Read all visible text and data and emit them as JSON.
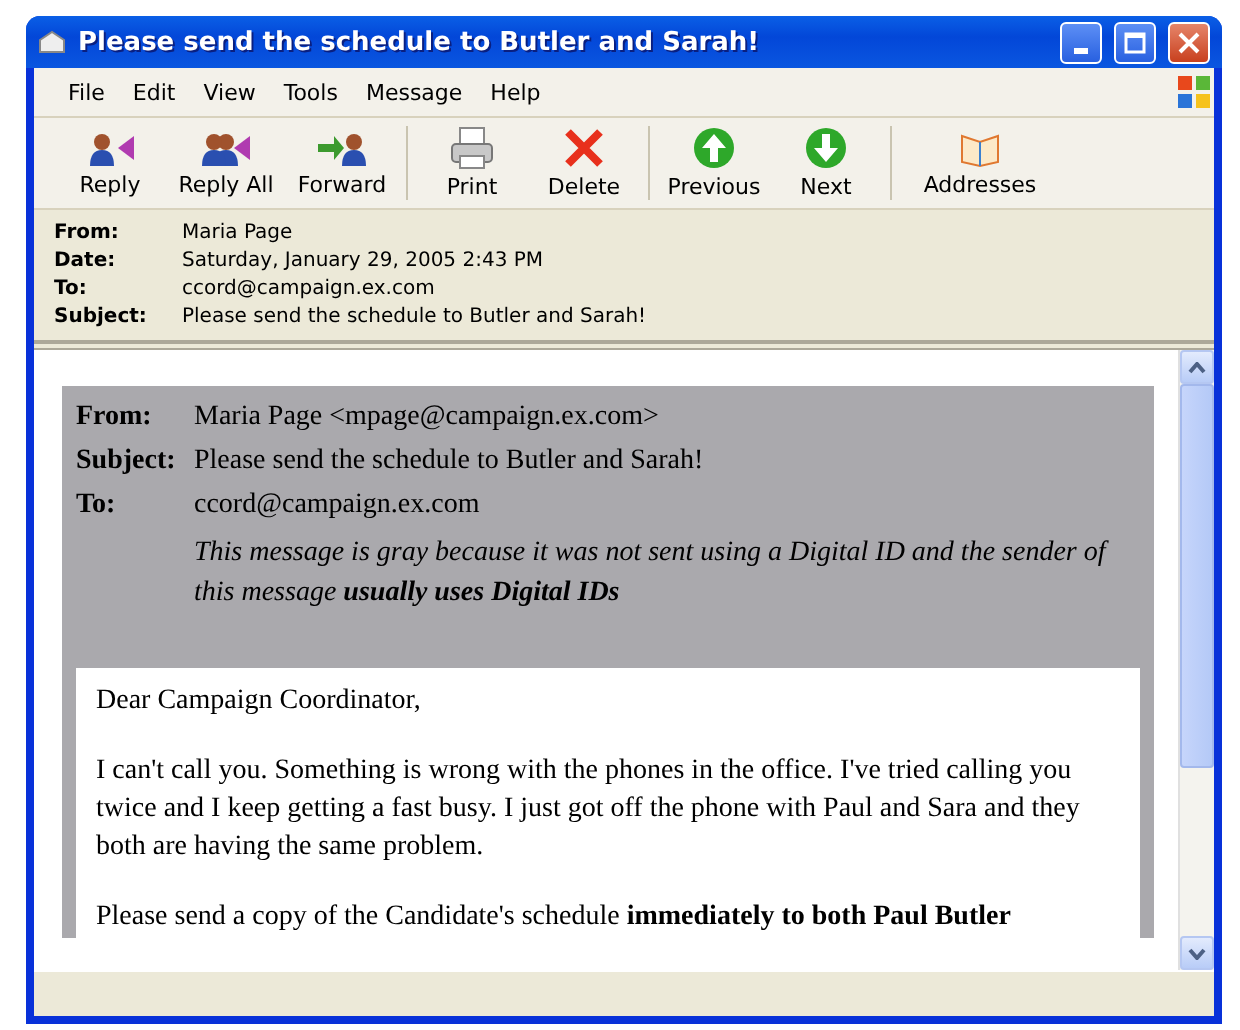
{
  "window": {
    "title": "Please send the schedule to Butler and Sarah!"
  },
  "menu": [
    "File",
    "Edit",
    "View",
    "Tools",
    "Message",
    "Help"
  ],
  "toolbar_groups": [
    [
      {
        "label": "Reply",
        "kind": "reply"
      },
      {
        "label": "Reply All",
        "kind": "replyall"
      },
      {
        "label": "Forward",
        "kind": "forward"
      }
    ],
    [
      {
        "label": "Print",
        "kind": "print"
      },
      {
        "label": "Delete",
        "kind": "delete"
      }
    ],
    [
      {
        "label": "Previous",
        "kind": "up"
      },
      {
        "label": "Next",
        "kind": "down"
      }
    ],
    [
      {
        "label": "Addresses",
        "kind": "book"
      }
    ]
  ],
  "header": [
    {
      "label": "From:",
      "value": "Maria Page"
    },
    {
      "label": "Date:",
      "value": "Saturday, January 29, 2005 2:43 PM"
    },
    {
      "label": "To:",
      "value": "ccord@campaign.ex.com"
    },
    {
      "label": "Subject:",
      "value": "Please send the schedule to Butler and Sarah!"
    }
  ],
  "message": {
    "fields": [
      {
        "label": "From:",
        "value": "Maria Page <mpage@campaign.ex.com>"
      },
      {
        "label": "Subject:",
        "value": "Please send the schedule to Butler and Sarah!"
      },
      {
        "label": "To:",
        "value": "ccord@campaign.ex.com"
      }
    ],
    "notice": "This message is gray because it was not sent using a Digital ID and the sender of this message **usually uses Digital IDs**",
    "paragraphs": [
      "Dear Campaign Coordinator,",
      "I can't call you. Something is wrong with the phones in the office. I've tried calling you twice and I keep getting a fast busy. I just got off the phone with Paul and Sara and they both are having the same problem.",
      "Please send a copy of the Candidate's schedule **immediately to both Paul Butler**"
    ]
  }
}
